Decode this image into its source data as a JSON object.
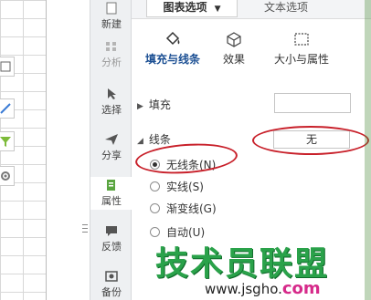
{
  "vertical_toolbar": {
    "items": [
      {
        "label": "新建",
        "icon": "new-icon"
      },
      {
        "label": "分析",
        "icon": "analysis-icon"
      },
      {
        "label": "选择",
        "icon": "select-icon"
      },
      {
        "label": "分享",
        "icon": "share-icon"
      },
      {
        "label": "属性",
        "icon": "properties-icon"
      },
      {
        "label": "反馈",
        "icon": "feedback-icon"
      },
      {
        "label": "备份",
        "icon": "backup-icon"
      }
    ]
  },
  "pane": {
    "tabs": [
      "图表选项",
      "文本选项"
    ],
    "subtabs": [
      "填充与线条",
      "效果",
      "大小与属性"
    ],
    "fill": {
      "label": "填充",
      "value": ""
    },
    "line": {
      "label": "线条",
      "value": "无",
      "options": [
        "无线条(N)",
        "实线(S)",
        "渐变线(G)",
        "自动(U)"
      ],
      "selected": "无线条(N)"
    }
  },
  "watermark": {
    "title": "技术员联盟",
    "url_prefix": "www.jsgho.",
    "url_suffix": "com"
  },
  "colors": {
    "highlight_oval": "#c8202a",
    "active_subtab_text": "#1b4f93",
    "watermark": "#2aa24a"
  }
}
